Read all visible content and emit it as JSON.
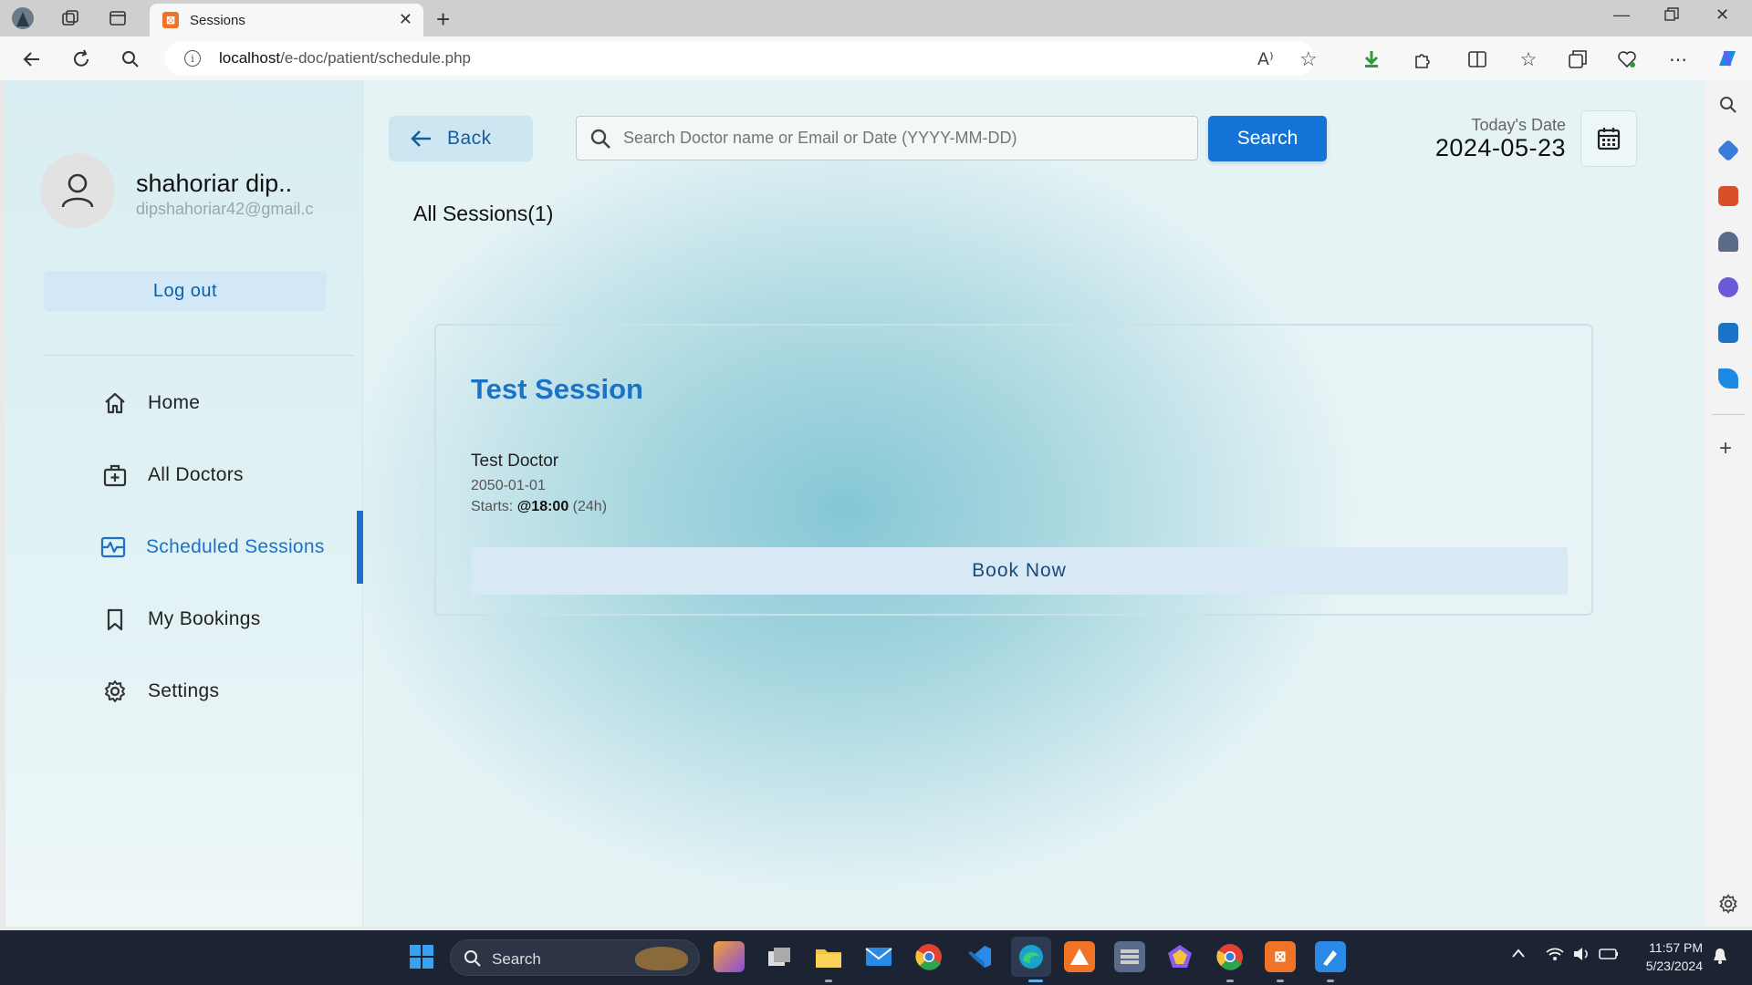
{
  "browser": {
    "tab_title": "Sessions",
    "tab_favicon_text": "⊠",
    "url_host": "localhost",
    "url_path": "/e-doc/patient/schedule.php",
    "read_aloud_label": "A⁾"
  },
  "profile": {
    "name": "shahoriar dip..",
    "email": "dipshahoriar42@gmail.c",
    "logout_label": "Log out"
  },
  "menu": {
    "items": [
      {
        "label": "Home",
        "icon": "home-icon",
        "active": false
      },
      {
        "label": "All Doctors",
        "icon": "doctor-bag-icon",
        "active": false
      },
      {
        "label": "Scheduled Sessions",
        "icon": "schedule-icon",
        "active": true
      },
      {
        "label": "My Bookings",
        "icon": "bookmark-icon",
        "active": false
      },
      {
        "label": "Settings",
        "icon": "gear-icon",
        "active": false
      }
    ]
  },
  "header": {
    "back_label": "Back",
    "search_placeholder": "Search Doctor name or Email or Date (YYYY-MM-DD)",
    "search_button": "Search",
    "date_label": "Today's Date",
    "date_value": "2024-05-23"
  },
  "main": {
    "heading": "All Sessions(1)",
    "sessions": [
      {
        "title": "Test Session",
        "doctor": "Test Doctor",
        "date": "2050-01-01",
        "start_prefix": "Starts: ",
        "start_time": "@18:00",
        "start_suffix": " (24h)",
        "book_label": "Book Now"
      }
    ]
  },
  "taskbar": {
    "search_label": "Search",
    "time": "11:57 PM",
    "date": "5/23/2024"
  },
  "colors": {
    "accent": "#1473d6",
    "active_menu": "#1a73c8",
    "logout_bg": "#d3e8f6",
    "book_bg": "#d8e9f5"
  }
}
